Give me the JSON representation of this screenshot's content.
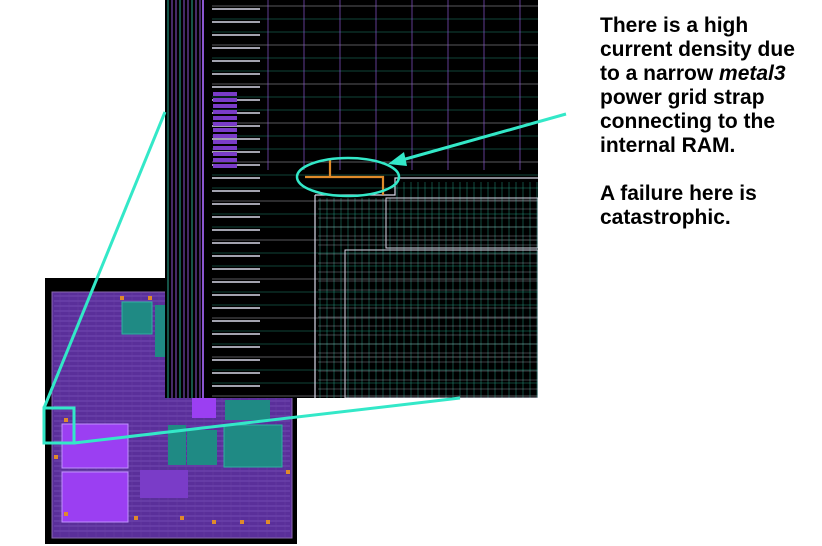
{
  "callout": {
    "line1": "There is a high current density due to a narrow",
    "italic_word": "metal3",
    "line2": " power grid strap connecting to the internal RAM.",
    "failure_text": "A failure here is catastrophic."
  },
  "colors": {
    "layout_background": "#000000",
    "metal_purple": "#7a3cc8",
    "ram_purple": "#9b3ff2",
    "teal_block": "#1f8a84",
    "strap_orange": "#e08a2a",
    "highlight_cyan": "#33e8c8",
    "grid_line_purple": "#8a55d0",
    "grid_line_teal": "#2aa890",
    "grid_line_white": "#d8d8e8"
  }
}
